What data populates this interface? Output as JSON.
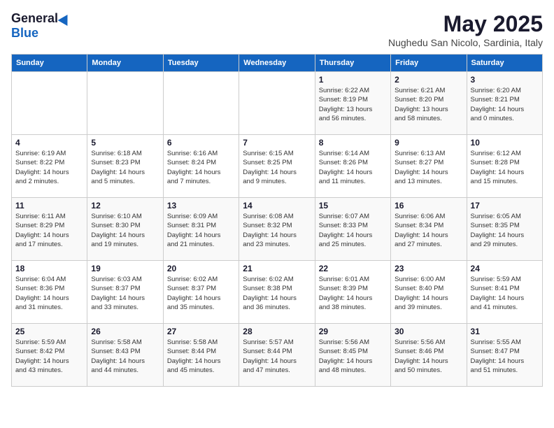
{
  "header": {
    "logo_general": "General",
    "logo_blue": "Blue",
    "month": "May 2025",
    "location": "Nughedu San Nicolo, Sardinia, Italy"
  },
  "weekdays": [
    "Sunday",
    "Monday",
    "Tuesday",
    "Wednesday",
    "Thursday",
    "Friday",
    "Saturday"
  ],
  "weeks": [
    [
      {
        "day": "",
        "info": ""
      },
      {
        "day": "",
        "info": ""
      },
      {
        "day": "",
        "info": ""
      },
      {
        "day": "",
        "info": ""
      },
      {
        "day": "1",
        "info": "Sunrise: 6:22 AM\nSunset: 8:19 PM\nDaylight: 13 hours\nand 56 minutes."
      },
      {
        "day": "2",
        "info": "Sunrise: 6:21 AM\nSunset: 8:20 PM\nDaylight: 13 hours\nand 58 minutes."
      },
      {
        "day": "3",
        "info": "Sunrise: 6:20 AM\nSunset: 8:21 PM\nDaylight: 14 hours\nand 0 minutes."
      }
    ],
    [
      {
        "day": "4",
        "info": "Sunrise: 6:19 AM\nSunset: 8:22 PM\nDaylight: 14 hours\nand 2 minutes."
      },
      {
        "day": "5",
        "info": "Sunrise: 6:18 AM\nSunset: 8:23 PM\nDaylight: 14 hours\nand 5 minutes."
      },
      {
        "day": "6",
        "info": "Sunrise: 6:16 AM\nSunset: 8:24 PM\nDaylight: 14 hours\nand 7 minutes."
      },
      {
        "day": "7",
        "info": "Sunrise: 6:15 AM\nSunset: 8:25 PM\nDaylight: 14 hours\nand 9 minutes."
      },
      {
        "day": "8",
        "info": "Sunrise: 6:14 AM\nSunset: 8:26 PM\nDaylight: 14 hours\nand 11 minutes."
      },
      {
        "day": "9",
        "info": "Sunrise: 6:13 AM\nSunset: 8:27 PM\nDaylight: 14 hours\nand 13 minutes."
      },
      {
        "day": "10",
        "info": "Sunrise: 6:12 AM\nSunset: 8:28 PM\nDaylight: 14 hours\nand 15 minutes."
      }
    ],
    [
      {
        "day": "11",
        "info": "Sunrise: 6:11 AM\nSunset: 8:29 PM\nDaylight: 14 hours\nand 17 minutes."
      },
      {
        "day": "12",
        "info": "Sunrise: 6:10 AM\nSunset: 8:30 PM\nDaylight: 14 hours\nand 19 minutes."
      },
      {
        "day": "13",
        "info": "Sunrise: 6:09 AM\nSunset: 8:31 PM\nDaylight: 14 hours\nand 21 minutes."
      },
      {
        "day": "14",
        "info": "Sunrise: 6:08 AM\nSunset: 8:32 PM\nDaylight: 14 hours\nand 23 minutes."
      },
      {
        "day": "15",
        "info": "Sunrise: 6:07 AM\nSunset: 8:33 PM\nDaylight: 14 hours\nand 25 minutes."
      },
      {
        "day": "16",
        "info": "Sunrise: 6:06 AM\nSunset: 8:34 PM\nDaylight: 14 hours\nand 27 minutes."
      },
      {
        "day": "17",
        "info": "Sunrise: 6:05 AM\nSunset: 8:35 PM\nDaylight: 14 hours\nand 29 minutes."
      }
    ],
    [
      {
        "day": "18",
        "info": "Sunrise: 6:04 AM\nSunset: 8:36 PM\nDaylight: 14 hours\nand 31 minutes."
      },
      {
        "day": "19",
        "info": "Sunrise: 6:03 AM\nSunset: 8:37 PM\nDaylight: 14 hours\nand 33 minutes."
      },
      {
        "day": "20",
        "info": "Sunrise: 6:02 AM\nSunset: 8:37 PM\nDaylight: 14 hours\nand 35 minutes."
      },
      {
        "day": "21",
        "info": "Sunrise: 6:02 AM\nSunset: 8:38 PM\nDaylight: 14 hours\nand 36 minutes."
      },
      {
        "day": "22",
        "info": "Sunrise: 6:01 AM\nSunset: 8:39 PM\nDaylight: 14 hours\nand 38 minutes."
      },
      {
        "day": "23",
        "info": "Sunrise: 6:00 AM\nSunset: 8:40 PM\nDaylight: 14 hours\nand 39 minutes."
      },
      {
        "day": "24",
        "info": "Sunrise: 5:59 AM\nSunset: 8:41 PM\nDaylight: 14 hours\nand 41 minutes."
      }
    ],
    [
      {
        "day": "25",
        "info": "Sunrise: 5:59 AM\nSunset: 8:42 PM\nDaylight: 14 hours\nand 43 minutes."
      },
      {
        "day": "26",
        "info": "Sunrise: 5:58 AM\nSunset: 8:43 PM\nDaylight: 14 hours\nand 44 minutes."
      },
      {
        "day": "27",
        "info": "Sunrise: 5:58 AM\nSunset: 8:44 PM\nDaylight: 14 hours\nand 45 minutes."
      },
      {
        "day": "28",
        "info": "Sunrise: 5:57 AM\nSunset: 8:44 PM\nDaylight: 14 hours\nand 47 minutes."
      },
      {
        "day": "29",
        "info": "Sunrise: 5:56 AM\nSunset: 8:45 PM\nDaylight: 14 hours\nand 48 minutes."
      },
      {
        "day": "30",
        "info": "Sunrise: 5:56 AM\nSunset: 8:46 PM\nDaylight: 14 hours\nand 50 minutes."
      },
      {
        "day": "31",
        "info": "Sunrise: 5:55 AM\nSunset: 8:47 PM\nDaylight: 14 hours\nand 51 minutes."
      }
    ]
  ]
}
